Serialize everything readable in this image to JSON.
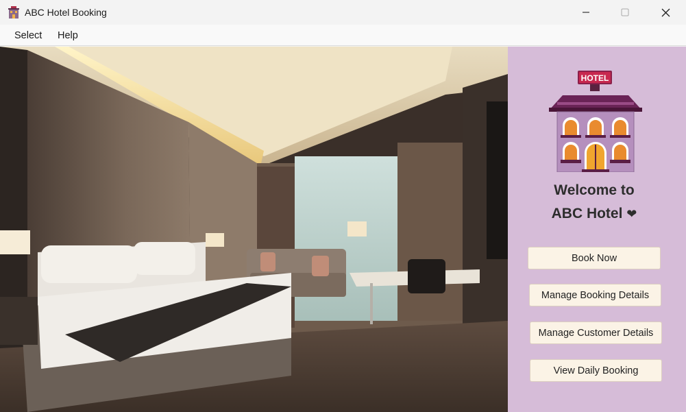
{
  "window": {
    "title": "ABC Hotel Booking",
    "icon": "hotel-icon"
  },
  "menu": {
    "items": [
      "Select",
      "Help"
    ]
  },
  "panel": {
    "background": "#d6bcd8",
    "logo_sign": "HOTEL",
    "welcome_line1": "Welcome to",
    "welcome_line2": "ABC Hotel",
    "heart": "❤",
    "buttons": {
      "book_now": "Book Now",
      "manage_booking": "Manage Booking Details",
      "manage_customer": "Manage Customer Details",
      "view_daily": "View Daily Booking"
    }
  }
}
